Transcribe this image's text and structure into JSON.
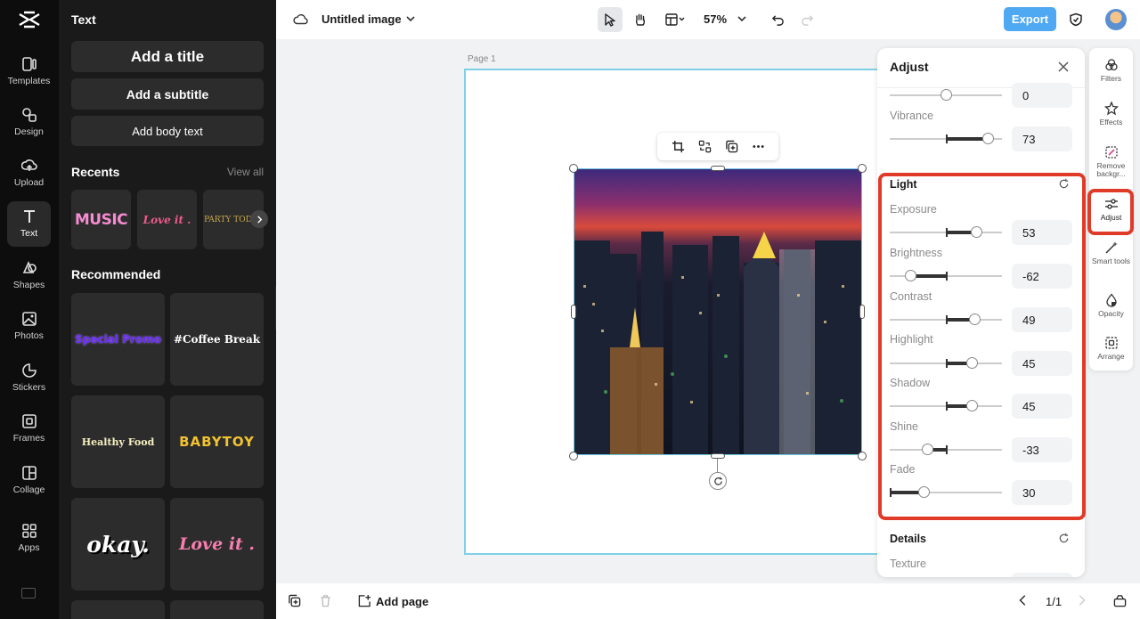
{
  "rail": {
    "items": [
      {
        "label": "Templates",
        "icon": "templates-icon"
      },
      {
        "label": "Design",
        "icon": "design-icon"
      },
      {
        "label": "Upload",
        "icon": "upload-icon"
      },
      {
        "label": "Text",
        "icon": "text-icon"
      },
      {
        "label": "Shapes",
        "icon": "shapes-icon"
      },
      {
        "label": "Photos",
        "icon": "photos-icon"
      },
      {
        "label": "Stickers",
        "icon": "stickers-icon"
      },
      {
        "label": "Frames",
        "icon": "frames-icon"
      },
      {
        "label": "Collage",
        "icon": "collage-icon"
      },
      {
        "label": "Apps",
        "icon": "apps-icon"
      }
    ]
  },
  "panel": {
    "title": "Text",
    "add_title": "Add a title",
    "add_subtitle": "Add a subtitle",
    "add_body": "Add body text",
    "recents_label": "Recents",
    "view_all": "View all",
    "recents": [
      "MUSIC",
      "Love it .",
      "PARTY TODAY"
    ],
    "recommended_label": "Recommended",
    "recommended": [
      "Special Promo",
      "#Coffee Break",
      "Healthy Food",
      "BABYTOY",
      "okay.",
      "Love it ."
    ]
  },
  "topbar": {
    "doc_title": "Untitled image",
    "zoom": "57%",
    "export": "Export"
  },
  "canvas": {
    "page_label": "Page 1"
  },
  "adjust": {
    "title": "Adjust",
    "top_value": "0",
    "vibrance_label": "Vibrance",
    "vibrance_value": "73",
    "light_title": "Light",
    "sliders": [
      {
        "label": "Exposure",
        "value": "53"
      },
      {
        "label": "Brightness",
        "value": "-62"
      },
      {
        "label": "Contrast",
        "value": "49"
      },
      {
        "label": "Highlight",
        "value": "45"
      },
      {
        "label": "Shadow",
        "value": "45"
      },
      {
        "label": "Shine",
        "value": "-33"
      },
      {
        "label": "Fade",
        "value": "30"
      }
    ],
    "details_title": "Details",
    "texture_label": "Texture"
  },
  "tools": [
    {
      "label": "Filters"
    },
    {
      "label": "Effects"
    },
    {
      "label": "Remove backgr..."
    },
    {
      "label": "Adjust"
    },
    {
      "label": "Smart tools"
    },
    {
      "label": "Opacity"
    },
    {
      "label": "Arrange"
    }
  ],
  "bottombar": {
    "add_page": "Add page",
    "page_count": "1/1"
  },
  "colors": {
    "accent": "#4ea8f2",
    "highlight": "#e03a28",
    "selection": "#7fd0e6"
  }
}
